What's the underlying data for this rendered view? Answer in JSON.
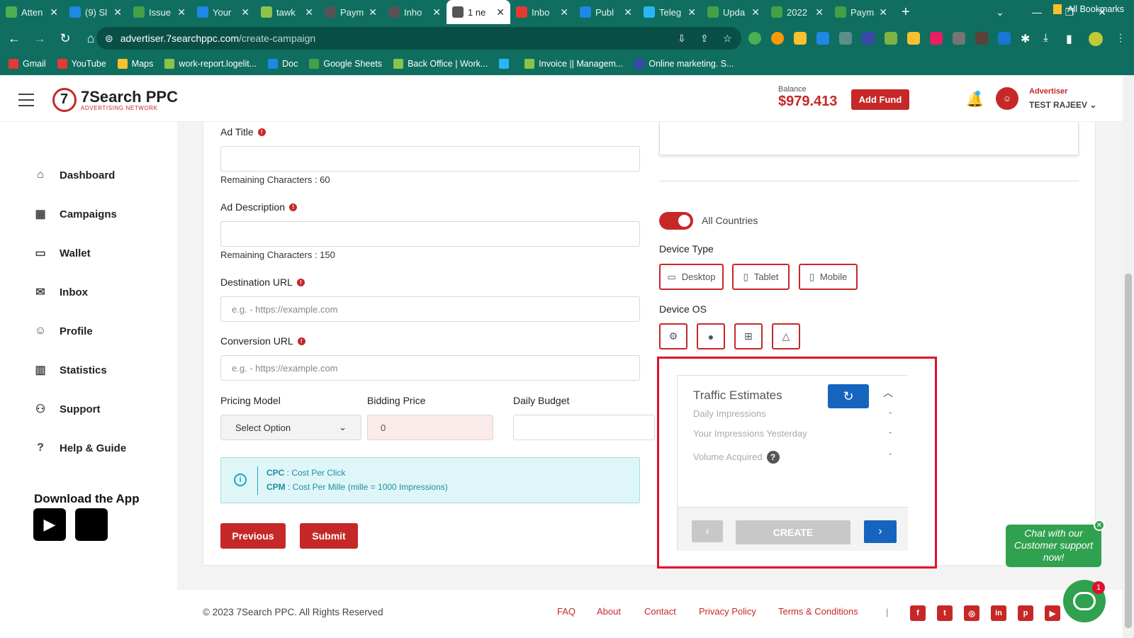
{
  "browser": {
    "tabs": [
      {
        "label": "Atten",
        "color": "#4caf50"
      },
      {
        "label": "(9) Sl",
        "color": "#1e88e5"
      },
      {
        "label": "Issue",
        "color": "#43a047"
      },
      {
        "label": "Your",
        "color": "#1e88e5"
      },
      {
        "label": "tawk",
        "color": "#8bc34a"
      },
      {
        "label": "Paym",
        "color": "#555555"
      },
      {
        "label": "Inho",
        "color": "#555555"
      },
      {
        "label": "1 ne",
        "color": "#555555",
        "active": true
      },
      {
        "label": "Inbo",
        "color": "#e53935"
      },
      {
        "label": "Publ",
        "color": "#1e88e5"
      },
      {
        "label": "Teleg",
        "color": "#29b6f6"
      },
      {
        "label": "Upda",
        "color": "#43a047"
      },
      {
        "label": "2022",
        "color": "#43a047"
      },
      {
        "label": "Paym",
        "color": "#43a047"
      }
    ],
    "url_host": "advertiser.7searchppc.com",
    "url_path": "/create-campaign",
    "bookmarks": [
      {
        "label": "Gmail",
        "color": "#e53935"
      },
      {
        "label": "YouTube",
        "color": "#e53935"
      },
      {
        "label": "Maps",
        "color": "#fbc02d"
      },
      {
        "label": "work-report.logelit...",
        "color": "#8bc34a"
      },
      {
        "label": "Doc",
        "color": "#1e88e5"
      },
      {
        "label": "Google Sheets",
        "color": "#43a047"
      },
      {
        "label": "Back Office | Work...",
        "color": "#8bc34a"
      },
      {
        "label": "",
        "color": "#29b6f6"
      },
      {
        "label": "Invoice || Managem...",
        "color": "#8bc34a"
      },
      {
        "label": "Online marketing. S...",
        "color": "#3949ab"
      }
    ],
    "all_bookmarks": "All Bookmarks"
  },
  "header": {
    "logo_name": "7Search PPC",
    "logo_tagline": "ADVERTISING NETWORK",
    "balance_label": "Balance",
    "balance_value": "$979.413",
    "add_fund": "Add Fund",
    "role": "Advertiser",
    "username": "TEST RAJEEV"
  },
  "sidebar": {
    "items": [
      {
        "label": "Dashboard",
        "icon": "home-icon",
        "glyph": "⌂"
      },
      {
        "label": "Campaigns",
        "icon": "grid-icon",
        "glyph": "▦"
      },
      {
        "label": "Wallet",
        "icon": "wallet-icon",
        "glyph": "▭"
      },
      {
        "label": "Inbox",
        "icon": "mail-icon",
        "glyph": "✉"
      },
      {
        "label": "Profile",
        "icon": "user-icon",
        "glyph": "☺"
      },
      {
        "label": "Statistics",
        "icon": "chart-icon",
        "glyph": "▥"
      },
      {
        "label": "Support",
        "icon": "support-icon",
        "glyph": "⚇"
      },
      {
        "label": "Help & Guide",
        "icon": "help-icon",
        "glyph": "?"
      }
    ],
    "download_title": "Download the App"
  },
  "form": {
    "ad_title_label": "Ad Title",
    "ad_title_remaining": "Remaining Characters : 60",
    "ad_desc_label": "Ad Description",
    "ad_desc_remaining": "Remaining Characters : 150",
    "dest_url_label": "Destination URL",
    "dest_url_placeholder": "e.g. - https://example.com",
    "conv_url_label": "Conversion URL",
    "conv_url_placeholder": "e.g. - https://example.com",
    "pricing_label": "Pricing Model",
    "pricing_value": "Select Option",
    "bidding_label": "Bidding Price",
    "bidding_value": "0",
    "budget_label": "Daily Budget",
    "info_cpc_key": "CPC",
    "info_cpc_text": " : Cost Per Click",
    "info_cpm_key": "CPM",
    "info_cpm_text": " : Cost Per Mille (mille = 1000 Impressions)",
    "previous": "Previous",
    "submit": "Submit"
  },
  "targeting": {
    "all_countries": "All Countries",
    "device_type_label": "Device Type",
    "devices": [
      "Desktop",
      "Tablet",
      "Mobile"
    ],
    "device_os_label": "Device OS"
  },
  "traffic": {
    "title": "Traffic Estimates",
    "rows": [
      {
        "label": "Daily Impressions",
        "value": "-"
      },
      {
        "label": "Your Impressions Yesterday",
        "value": "-"
      },
      {
        "label": "Volume Acquired",
        "value": "-"
      }
    ],
    "help_glyph": "?",
    "create": "CREATE"
  },
  "footer": {
    "copyright": "© 2023 7Search PPC. All Rights Reserved",
    "links": [
      "FAQ",
      "About",
      "Contact",
      "Privacy Policy",
      "Terms & Conditions"
    ],
    "divider": "|"
  },
  "chat": {
    "bubble": "Chat with our Customer support now!",
    "badge": "1"
  },
  "colors": {
    "brand_red": "#c62828",
    "chrome_green": "#0f6e5f",
    "primary_blue": "#1565c0",
    "chat_green": "#30a14e"
  }
}
